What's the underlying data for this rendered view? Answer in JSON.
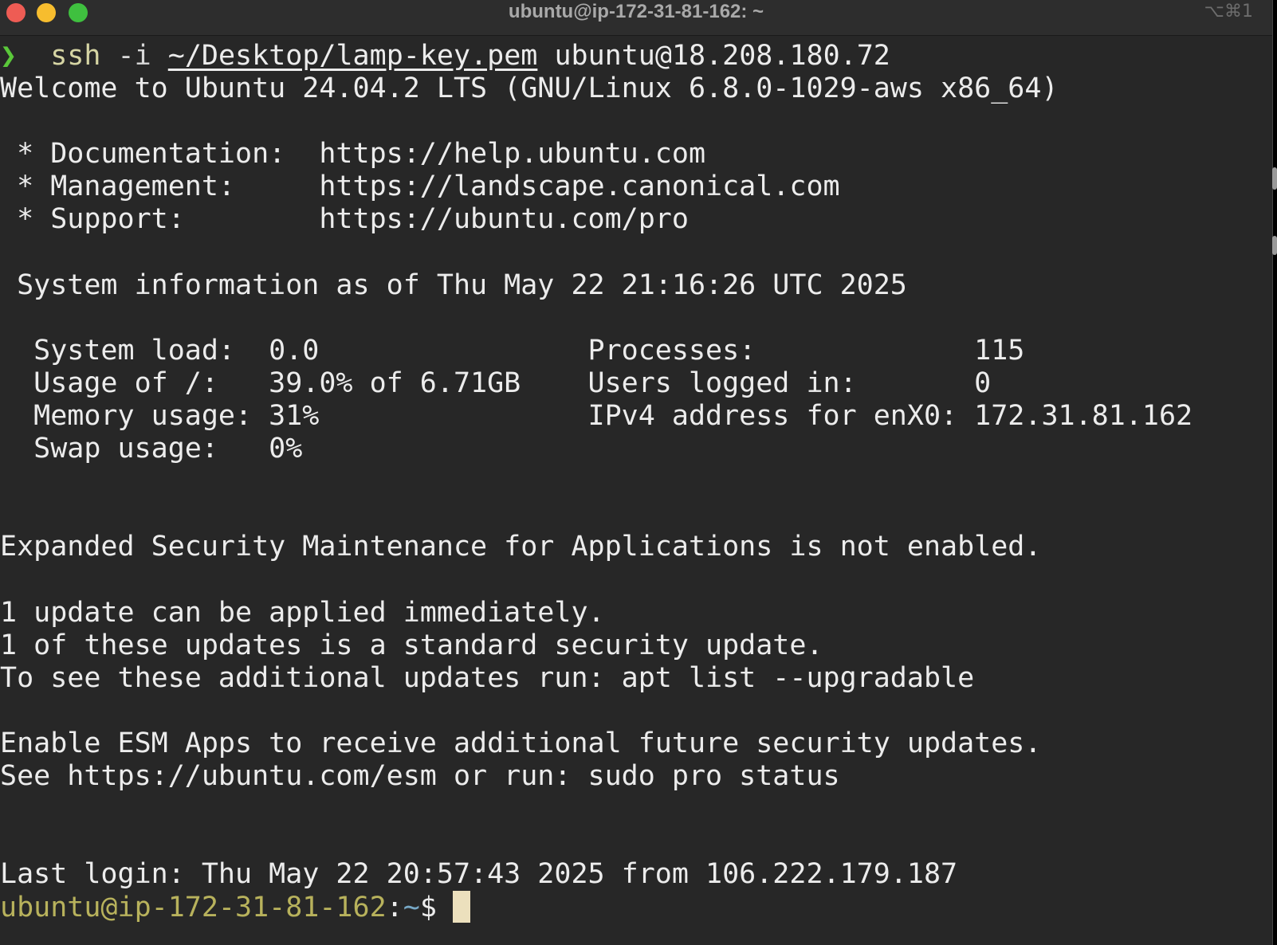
{
  "window": {
    "title": "ubuntu@ip-172-31-81-162: ~",
    "shortcut": "⌥⌘1"
  },
  "colors": {
    "background": "#272727",
    "prompt_chevron": "#5ac83a",
    "prompt_user": "#b8b25c",
    "prompt_path": "#77a8c6",
    "cursor": "#ece0bd"
  },
  "command": {
    "chevron": "❯",
    "program": "ssh",
    "flag": "-i",
    "key_path": "~/Desktop/lamp-key.pem",
    "target": "ubuntu@18.208.180.72"
  },
  "output": {
    "welcome": "Welcome to Ubuntu 24.04.2 LTS (GNU/Linux 6.8.0-1029-aws x86_64)",
    "doc_line": " * Documentation:  https://help.ubuntu.com",
    "mgmt_line": " * Management:     https://landscape.canonical.com",
    "support_line": " * Support:        https://ubuntu.com/pro",
    "sysinfo_header": " System information as of Thu May 22 21:16:26 UTC 2025",
    "sys_line1": "  System load:  0.0                Processes:             115",
    "sys_line2": "  Usage of /:   39.0% of 6.71GB    Users logged in:       0",
    "sys_line3": "  Memory usage: 31%                IPv4 address for enX0: 172.31.81.162",
    "sys_line4": "  Swap usage:   0%",
    "esm_line": "Expanded Security Maintenance for Applications is not enabled.",
    "update_line1": "1 update can be applied immediately.",
    "update_line2": "1 of these updates is a standard security update.",
    "update_line3": "To see these additional updates run: apt list --upgradable",
    "esm_apps_line1": "Enable ESM Apps to receive additional future security updates.",
    "esm_apps_line2": "See https://ubuntu.com/esm or run: sudo pro status",
    "last_login": "Last login: Thu May 22 20:57:43 2025 from 106.222.179.187"
  },
  "prompt": {
    "user_host": "ubuntu@ip-172-31-81-162",
    "colon": ":",
    "path": "~",
    "symbol": "$"
  }
}
